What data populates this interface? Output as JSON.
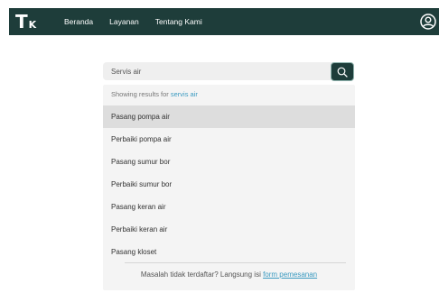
{
  "nav": {
    "logo_main": "T",
    "logo_sub": "K",
    "links": [
      "Beranda",
      "Layanan",
      "Tentang Kami"
    ],
    "user_icon": "user-circle-icon"
  },
  "search": {
    "value": "Servis air",
    "button_icon": "search-icon"
  },
  "dropdown": {
    "showing_prefix": "Showing results for",
    "query": "servis air",
    "results": [
      "Pasang pompa air",
      "Perbaiki pompa air",
      "Pasang sumur bor",
      "Perbaiki sumur bor",
      "Pasang keran air",
      "Perbaiki keran air",
      "Pasang kloset"
    ],
    "active_index": 0,
    "footer_text": "Masalah tidak terdaftar? Langsung isi",
    "footer_link": "form pemesanan"
  },
  "colors": {
    "brand_dark": "#1e3d3a",
    "accent_link": "#3a9ac0"
  }
}
